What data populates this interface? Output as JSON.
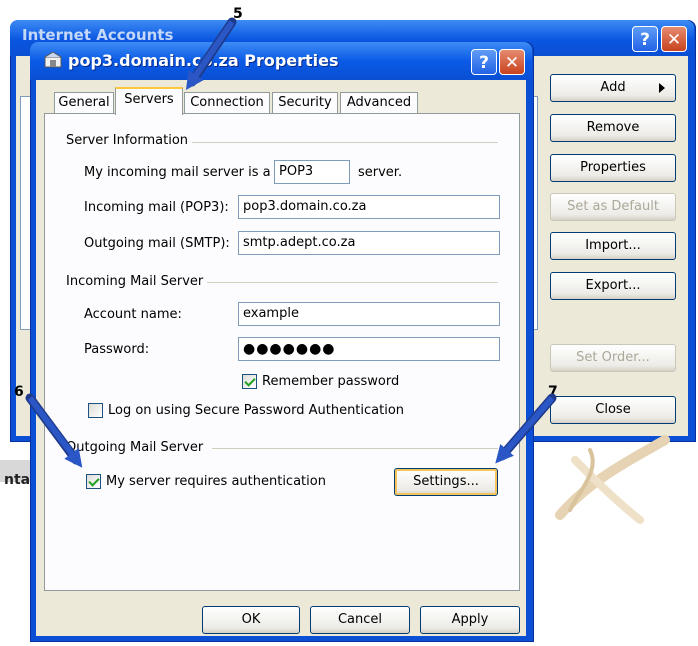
{
  "background_window": {
    "title": "Internet Accounts",
    "buttons": {
      "add": "Add",
      "remove": "Remove",
      "properties": "Properties",
      "set_default": "Set as Default",
      "import": "Import...",
      "export": "Export...",
      "set_order": "Set Order...",
      "close": "Close"
    },
    "partial_text": "nta",
    "help_glyph": "?",
    "close_glyph": "✕"
  },
  "dialog": {
    "title": "pop3.domain.co.za Properties",
    "help_glyph": "?",
    "close_glyph": "✕",
    "tabs": [
      {
        "label": "General",
        "active": false
      },
      {
        "label": "Servers",
        "active": true
      },
      {
        "label": "Connection",
        "active": false
      },
      {
        "label": "Security",
        "active": false
      },
      {
        "label": "Advanced",
        "active": false
      }
    ],
    "server_information": {
      "group_label": "Server Information",
      "server_type_prefix": "My incoming mail server is a",
      "server_type_value": "POP3",
      "server_type_suffix": "server.",
      "incoming_label": "Incoming mail (POP3):",
      "incoming_value": "pop3.domain.co.za",
      "outgoing_label": "Outgoing mail (SMTP):",
      "outgoing_value": "smtp.adept.co.za"
    },
    "incoming_mail_server": {
      "group_label": "Incoming Mail Server",
      "account_label": "Account name:",
      "account_value": "example",
      "password_label": "Password:",
      "password_value": "●●●●●●●",
      "remember_label": "Remember password",
      "remember_checked": true,
      "spa_label": "Log on using Secure Password Authentication",
      "spa_checked": false
    },
    "outgoing_mail_server": {
      "group_label": "Outgoing Mail Server",
      "auth_label": "My server requires authentication",
      "auth_checked": true,
      "settings_button": "Settings..."
    },
    "buttons": {
      "ok": "OK",
      "cancel": "Cancel",
      "apply": "Apply"
    }
  },
  "callouts": {
    "c5": "5",
    "c6": "6",
    "c7": "7"
  },
  "colors": {
    "arrow": "#2a56c6",
    "titlebar": "#0a4fd4",
    "face": "#ece9d8"
  }
}
